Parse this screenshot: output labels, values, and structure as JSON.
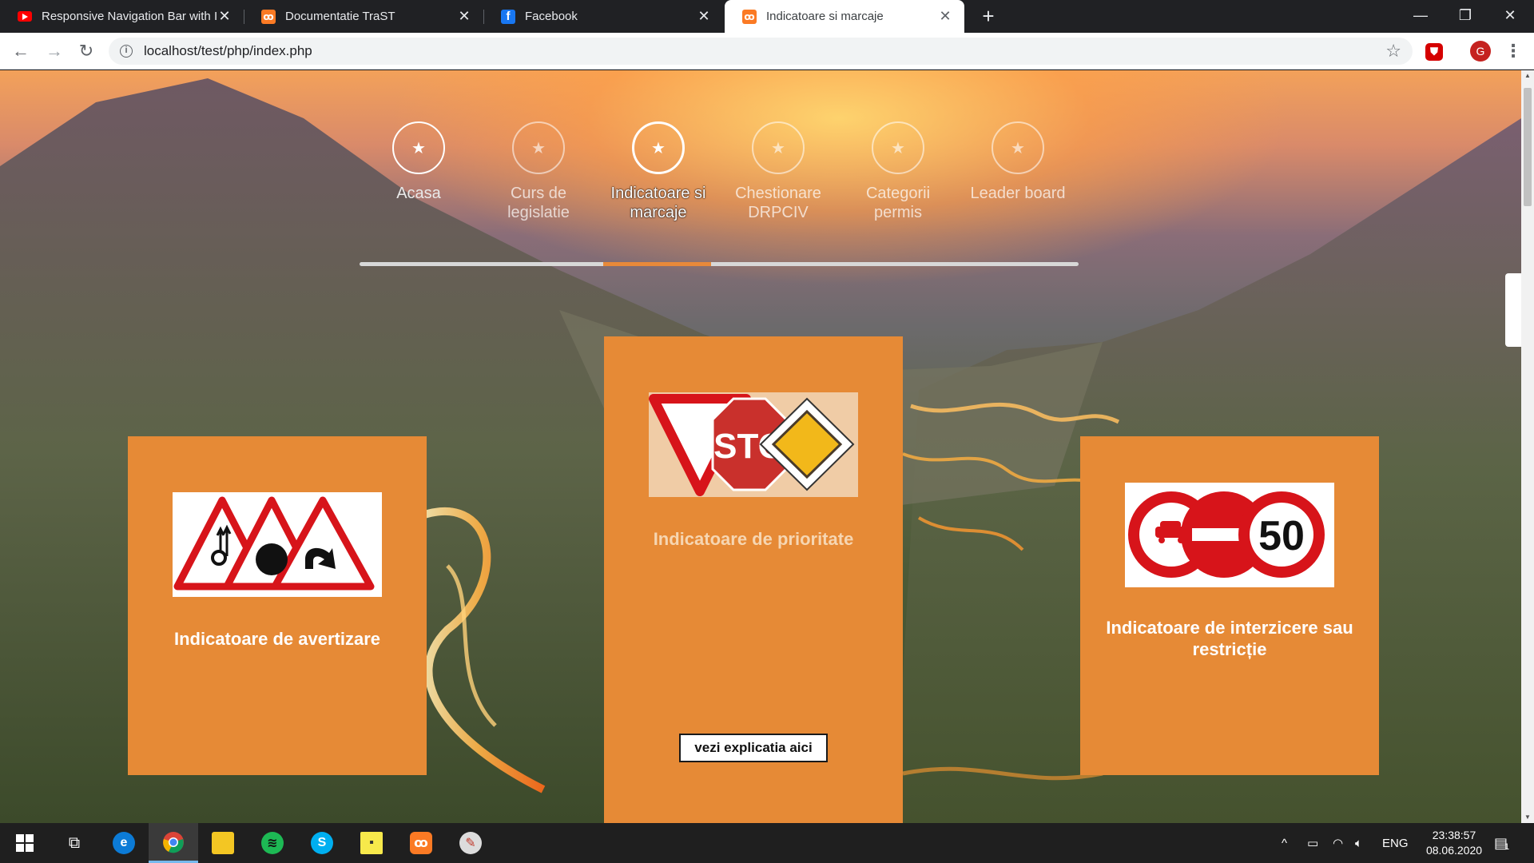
{
  "browser": {
    "tabs": [
      {
        "title": "Responsive Navigation Bar with I",
        "icon": "youtube-icon",
        "active": false
      },
      {
        "title": "Documentatie TraST",
        "icon": "xampp-icon",
        "active": false
      },
      {
        "title": "Facebook",
        "icon": "facebook-icon",
        "active": false
      },
      {
        "title": "Indicatoare si marcaje",
        "icon": "xampp-icon",
        "active": true
      }
    ],
    "url": "localhost/test/php/index.php",
    "profile_initial": "G"
  },
  "nav": {
    "items": [
      {
        "label": "Acasa",
        "state": "done"
      },
      {
        "label": "Curs de legislatie",
        "state": "pending"
      },
      {
        "label": "Indicatoare si marcaje",
        "state": "active"
      },
      {
        "label": "Chestionare DRPCIV",
        "state": "pending"
      },
      {
        "label": "Categorii permis",
        "state": "pending"
      },
      {
        "label": "Leader board",
        "state": "pending"
      }
    ],
    "progress_fraction_start": 0.339,
    "progress_fraction_end": 0.489,
    "accent": "#e8893a"
  },
  "cards": {
    "left": {
      "title": "Indicatoare de avertizare"
    },
    "center": {
      "title": "Indicatoare de prioritate",
      "button": "vezi explicatia aici",
      "sign_text": "STO"
    },
    "right": {
      "title": "Indicatoare de interzicere sau restricție",
      "sign_number": "50"
    }
  },
  "card_color": "#e68a36",
  "taskbar": {
    "language": "ENG",
    "time": "23:38:57",
    "date": "08.06.2020",
    "notifications": "1"
  }
}
